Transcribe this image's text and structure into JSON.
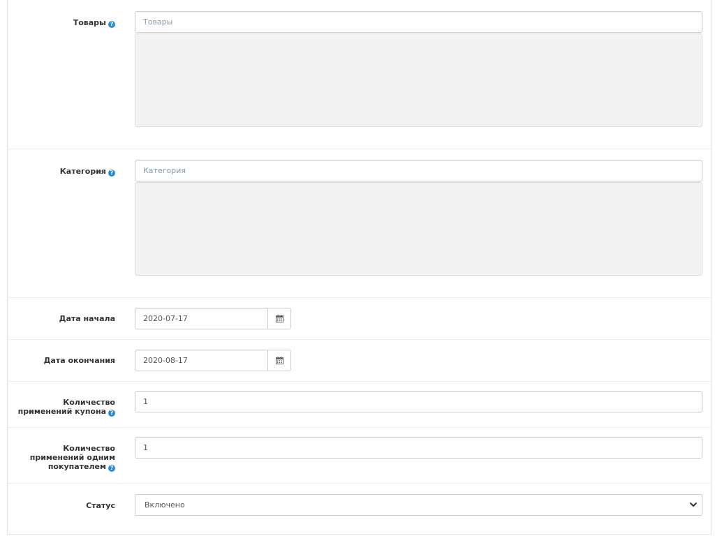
{
  "form": {
    "products": {
      "label": "Товары",
      "placeholder": "Товары",
      "help_icon": "question-circle"
    },
    "category": {
      "label": "Категория",
      "placeholder": "Категория",
      "help_icon": "question-circle"
    },
    "date_start": {
      "label": "Дата начала",
      "value": "2020-07-17",
      "button_icon": "calendar"
    },
    "date_end": {
      "label": "Дата окончания",
      "value": "2020-08-17",
      "button_icon": "calendar"
    },
    "uses_total": {
      "label_line1": "Количество",
      "label_line2": "применений купона",
      "value": "1",
      "help_icon": "question-circle"
    },
    "uses_customer": {
      "label_line1": "Количество",
      "label_line2": "применений одним",
      "label_line3": "покупателем",
      "value": "1",
      "help_icon": "question-circle"
    },
    "status": {
      "label": "Статус",
      "selected": "Включено",
      "dropdown_icon": "chevron-down"
    }
  },
  "colors": {
    "help_icon": "#2f8cc9",
    "well_bg": "#f3f3f3",
    "border": "#cccccc",
    "placeholder": "#8a9aa8"
  }
}
